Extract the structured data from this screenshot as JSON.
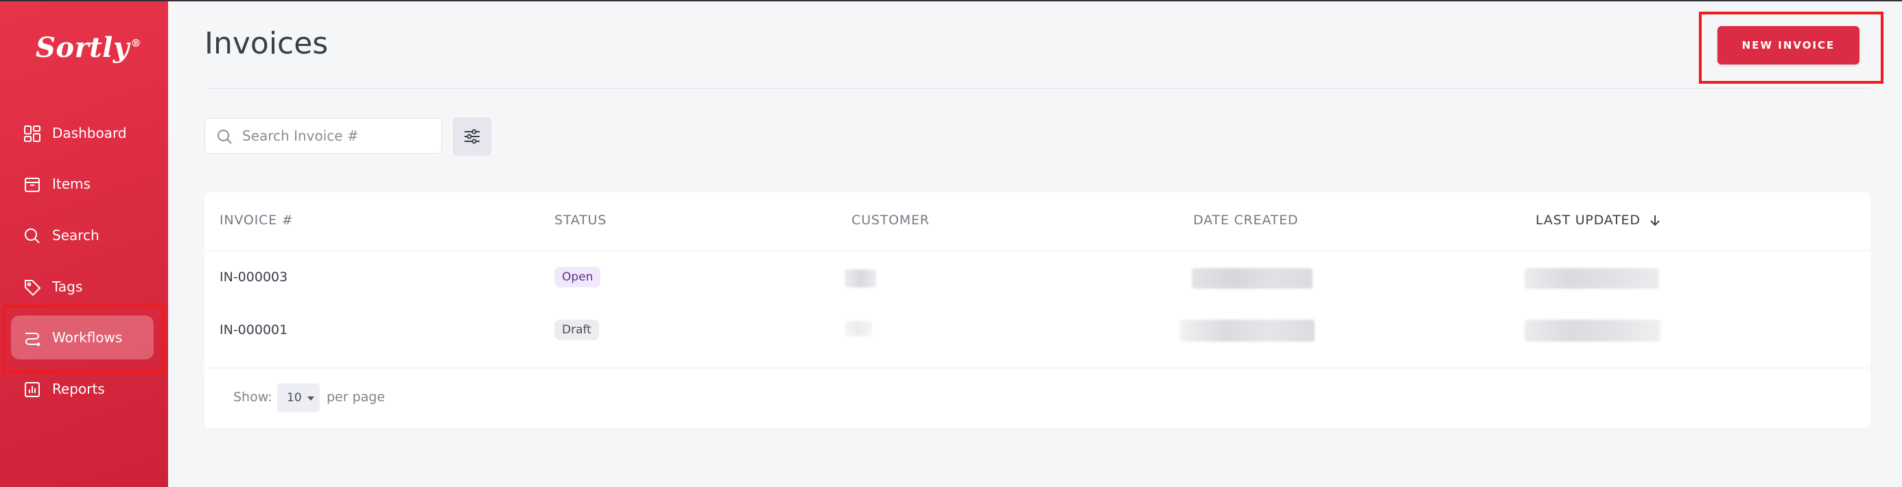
{
  "app": {
    "logo": "Sortly",
    "logo_mark": "®"
  },
  "sidebar": {
    "items": [
      {
        "label": "Dashboard",
        "icon": "dashboard-icon",
        "active": false
      },
      {
        "label": "Items",
        "icon": "items-icon",
        "active": false
      },
      {
        "label": "Search",
        "icon": "search-icon",
        "active": false
      },
      {
        "label": "Tags",
        "icon": "tag-icon",
        "active": false
      },
      {
        "label": "Workflows",
        "icon": "workflows-icon",
        "active": true
      },
      {
        "label": "Reports",
        "icon": "reports-icon",
        "active": false
      }
    ]
  },
  "header": {
    "title": "Invoices",
    "new_button": "NEW INVOICE"
  },
  "toolbar": {
    "search_placeholder": "Search Invoice #",
    "filter_icon": "sliders-icon"
  },
  "table": {
    "columns": [
      "INVOICE #",
      "STATUS",
      "CUSTOMER",
      "DATE CREATED",
      "LAST UPDATED"
    ],
    "sorted_column": "LAST UPDATED",
    "sort_icon": "arrow-down-icon",
    "rows": [
      {
        "invoice": "IN-000003",
        "status": "Open"
      },
      {
        "invoice": "IN-000001",
        "status": "Draft"
      }
    ]
  },
  "pagination": {
    "show_label": "Show:",
    "per_page_value": "10",
    "per_page_label": "per page"
  },
  "colors": {
    "brand": "#dc2b45",
    "sidebar": "#e8344a",
    "highlight": "#ee1c1c",
    "open_badge": "#f1e9fb",
    "draft_badge": "#ececf1"
  }
}
